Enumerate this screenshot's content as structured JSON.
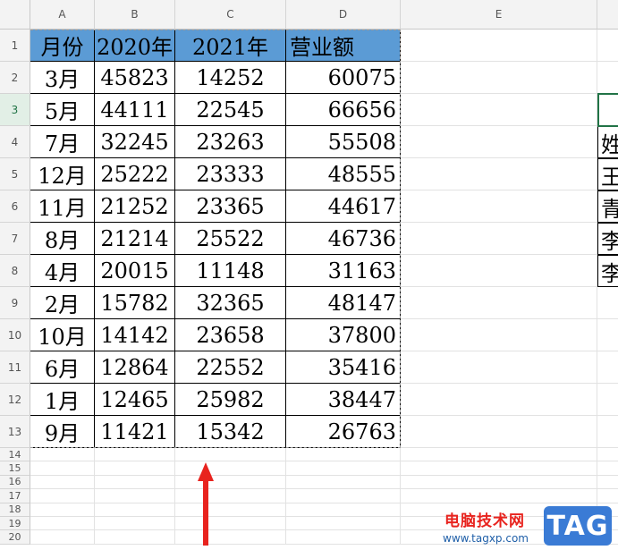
{
  "sheet": {
    "column_headers": [
      "A",
      "B",
      "C",
      "D",
      "E"
    ],
    "row_numbers": [
      "1",
      "2",
      "3",
      "4",
      "5",
      "6",
      "7",
      "8",
      "9",
      "10",
      "11",
      "12",
      "13",
      "14",
      "15",
      "16",
      "17",
      "18",
      "19",
      "20"
    ],
    "active_row": "3",
    "table_header": [
      "月份",
      "2020年",
      "2021年",
      "营业额"
    ],
    "rows": [
      [
        "3月",
        "45823",
        "14252",
        "60075"
      ],
      [
        "5月",
        "44111",
        "22545",
        "66656"
      ],
      [
        "7月",
        "32245",
        "23263",
        "55508"
      ],
      [
        "12月",
        "25222",
        "23333",
        "48555"
      ],
      [
        "11月",
        "21252",
        "23365",
        "44617"
      ],
      [
        "8月",
        "21214",
        "25522",
        "46736"
      ],
      [
        "4月",
        "20015",
        "11148",
        "31163"
      ],
      [
        "2月",
        "15782",
        "32365",
        "48147"
      ],
      [
        "10月",
        "14142",
        "23658",
        "37800"
      ],
      [
        "6月",
        "12864",
        "22552",
        "35416"
      ],
      [
        "1月",
        "12465",
        "25982",
        "38447"
      ],
      [
        "9月",
        "11421",
        "15342",
        "26763"
      ]
    ],
    "f_column_cells": [
      "",
      "姓",
      "王",
      "青",
      "李",
      "李"
    ]
  },
  "watermark": {
    "site_text": "电脑技术网",
    "url": "www.tagxp.com",
    "tag": "TAG"
  },
  "colors": {
    "header_fill": "#5b9bd5",
    "selection": "#217346",
    "arrow": "#e8231e"
  }
}
